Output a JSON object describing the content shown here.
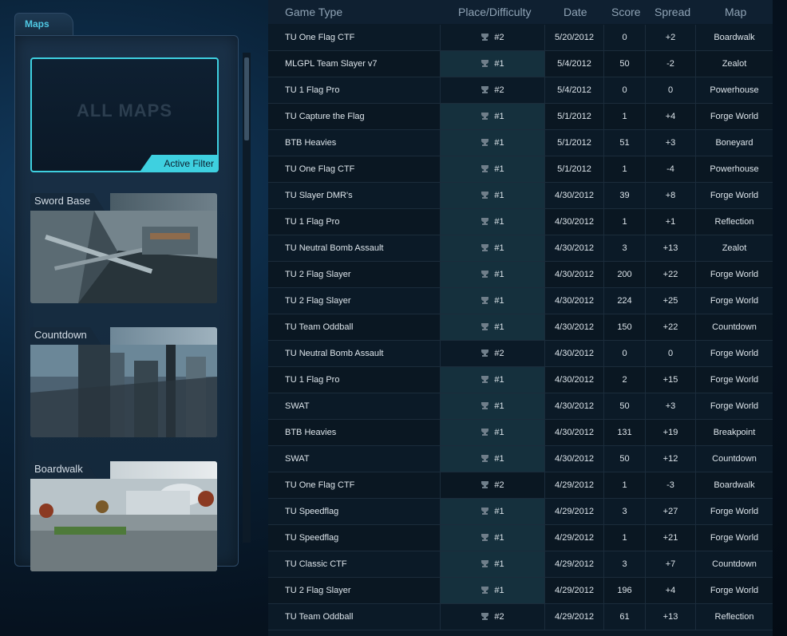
{
  "sidebar": {
    "tab_label": "Maps",
    "all_maps_label": "ALL MAPS",
    "active_filter_label": "Active Filter",
    "maps": [
      {
        "name": "Sword Base"
      },
      {
        "name": "Countdown"
      },
      {
        "name": "Boardwalk"
      }
    ]
  },
  "table": {
    "columns": [
      "Game Type",
      "Place/Difficulty",
      "Date",
      "Score",
      "Spread",
      "Map"
    ],
    "rows": [
      {
        "game": "TU One Flag CTF",
        "place": "#2",
        "date": "5/20/2012",
        "score": "0",
        "spread": "+2",
        "map": "Boardwalk"
      },
      {
        "game": "MLGPL Team Slayer v7",
        "place": "#1",
        "date": "5/4/2012",
        "score": "50",
        "spread": "-2",
        "map": "Zealot"
      },
      {
        "game": "TU 1 Flag Pro",
        "place": "#2",
        "date": "5/4/2012",
        "score": "0",
        "spread": "0",
        "map": "Powerhouse"
      },
      {
        "game": "TU Capture the Flag",
        "place": "#1",
        "date": "5/1/2012",
        "score": "1",
        "spread": "+4",
        "map": "Forge World"
      },
      {
        "game": "BTB Heavies",
        "place": "#1",
        "date": "5/1/2012",
        "score": "51",
        "spread": "+3",
        "map": "Boneyard"
      },
      {
        "game": "TU One Flag CTF",
        "place": "#1",
        "date": "5/1/2012",
        "score": "1",
        "spread": "-4",
        "map": "Powerhouse"
      },
      {
        "game": "TU Slayer DMR's",
        "place": "#1",
        "date": "4/30/2012",
        "score": "39",
        "spread": "+8",
        "map": "Forge World"
      },
      {
        "game": "TU 1 Flag Pro",
        "place": "#1",
        "date": "4/30/2012",
        "score": "1",
        "spread": "+1",
        "map": "Reflection"
      },
      {
        "game": "TU Neutral Bomb Assault",
        "place": "#1",
        "date": "4/30/2012",
        "score": "3",
        "spread": "+13",
        "map": "Zealot"
      },
      {
        "game": "TU 2 Flag Slayer",
        "place": "#1",
        "date": "4/30/2012",
        "score": "200",
        "spread": "+22",
        "map": "Forge World"
      },
      {
        "game": "TU 2 Flag Slayer",
        "place": "#1",
        "date": "4/30/2012",
        "score": "224",
        "spread": "+25",
        "map": "Forge World"
      },
      {
        "game": "TU Team Oddball",
        "place": "#1",
        "date": "4/30/2012",
        "score": "150",
        "spread": "+22",
        "map": "Countdown"
      },
      {
        "game": "TU Neutral Bomb Assault",
        "place": "#2",
        "date": "4/30/2012",
        "score": "0",
        "spread": "0",
        "map": "Forge World"
      },
      {
        "game": "TU 1 Flag Pro",
        "place": "#1",
        "date": "4/30/2012",
        "score": "2",
        "spread": "+15",
        "map": "Forge World"
      },
      {
        "game": "SWAT",
        "place": "#1",
        "date": "4/30/2012",
        "score": "50",
        "spread": "+3",
        "map": "Forge World"
      },
      {
        "game": "BTB Heavies",
        "place": "#1",
        "date": "4/30/2012",
        "score": "131",
        "spread": "+19",
        "map": "Breakpoint"
      },
      {
        "game": "SWAT",
        "place": "#1",
        "date": "4/30/2012",
        "score": "50",
        "spread": "+12",
        "map": "Countdown"
      },
      {
        "game": "TU One Flag CTF",
        "place": "#2",
        "date": "4/29/2012",
        "score": "1",
        "spread": "-3",
        "map": "Boardwalk"
      },
      {
        "game": "TU Speedflag",
        "place": "#1",
        "date": "4/29/2012",
        "score": "3",
        "spread": "+27",
        "map": "Forge World"
      },
      {
        "game": "TU Speedflag",
        "place": "#1",
        "date": "4/29/2012",
        "score": "1",
        "spread": "+21",
        "map": "Forge World"
      },
      {
        "game": "TU Classic CTF",
        "place": "#1",
        "date": "4/29/2012",
        "score": "3",
        "spread": "+7",
        "map": "Countdown"
      },
      {
        "game": "TU 2 Flag Slayer",
        "place": "#1",
        "date": "4/29/2012",
        "score": "196",
        "spread": "+4",
        "map": "Forge World"
      },
      {
        "game": "TU Team Oddball",
        "place": "#2",
        "date": "4/29/2012",
        "score": "61",
        "spread": "+13",
        "map": "Reflection"
      }
    ]
  },
  "colors": {
    "accent": "#3ed0e0",
    "win_cell": "#15303d",
    "header_text": "#8fa3b5"
  }
}
